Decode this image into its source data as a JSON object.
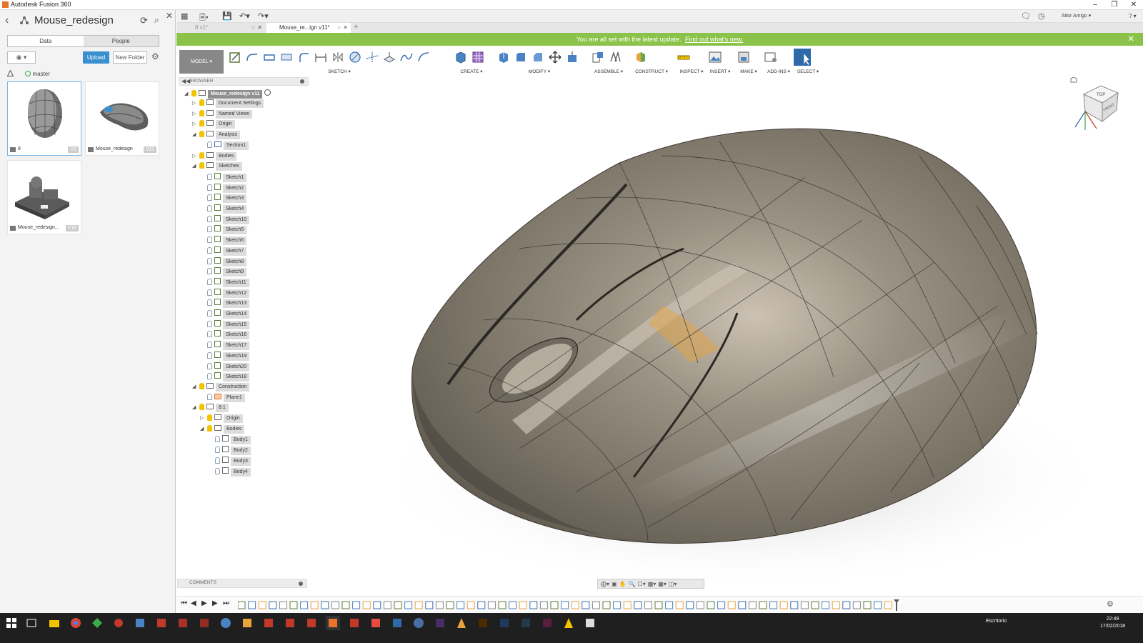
{
  "window": {
    "title": "Autodesk Fusion 360",
    "minimize": "–",
    "restore": "❐",
    "close": "✕"
  },
  "data_panel": {
    "back": "‹",
    "project_title": "Mouse_redesign",
    "refresh": "⟳",
    "search": "⌕",
    "close": "✕",
    "tabs": [
      "Data",
      "People"
    ],
    "active_tab": "Data",
    "view_toggle": "◉ ▾",
    "upload_label": "Upload",
    "new_folder_label": "New Folder",
    "settings": "⚙",
    "branch": "master",
    "files": [
      {
        "name": "8",
        "version": "V1"
      },
      {
        "name": "Mouse_redesign",
        "version": "V11"
      },
      {
        "name": "Mouse_redesign...",
        "version": "V16"
      }
    ]
  },
  "app_toolbar": {
    "user": "Aitor Amigo ▾",
    "help": "? ▾"
  },
  "doc_tabs": [
    {
      "label": "8 v1*",
      "active": false
    },
    {
      "label": "Mouse_re...ign v11*",
      "active": true
    }
  ],
  "banner": {
    "message": "You are all set with the latest update.",
    "link": "Find out what's new.",
    "close": "✕"
  },
  "ribbon": {
    "workspace": "MODEL ▾",
    "groups": [
      "SKETCH ▾",
      "CREATE ▾",
      "MODIFY ▾",
      "ASSEMBLE ▾",
      "CONSTRUCT ▾",
      "INSPECT ▾",
      "INSERT ▾",
      "MAKE ▾",
      "ADD-INS ▾",
      "SELECT ▾"
    ]
  },
  "browser": {
    "title": "BROWSER",
    "root": "Mouse_redesign v11",
    "nodes": [
      {
        "label": "Document Settings",
        "type": "gear",
        "expanded": false
      },
      {
        "label": "Named Views",
        "type": "folder",
        "expanded": false
      },
      {
        "label": "Origin",
        "type": "folder",
        "expanded": false
      },
      {
        "label": "Analysis",
        "type": "folder",
        "expanded": true
      },
      {
        "label": "Section1",
        "type": "section"
      },
      {
        "label": "Bodies",
        "type": "folder",
        "expanded": false
      },
      {
        "label": "Sketches",
        "type": "folder",
        "expanded": true
      },
      {
        "label": "Sketch1",
        "type": "sketch"
      },
      {
        "label": "Sketch2",
        "type": "sketch"
      },
      {
        "label": "Sketch3",
        "type": "sketch"
      },
      {
        "label": "Sketch4",
        "type": "sketch"
      },
      {
        "label": "Sketch10",
        "type": "sketch"
      },
      {
        "label": "Sketch5",
        "type": "sketch"
      },
      {
        "label": "Sketch6",
        "type": "sketch"
      },
      {
        "label": "Sketch7",
        "type": "sketch"
      },
      {
        "label": "Sketch8",
        "type": "sketch"
      },
      {
        "label": "Sketch9",
        "type": "sketch"
      },
      {
        "label": "Sketch11",
        "type": "sketch"
      },
      {
        "label": "Sketch12",
        "type": "sketch"
      },
      {
        "label": "Sketch13",
        "type": "sketch"
      },
      {
        "label": "Sketch14",
        "type": "sketch"
      },
      {
        "label": "Sketch15",
        "type": "sketch"
      },
      {
        "label": "Sketch16",
        "type": "sketch"
      },
      {
        "label": "Sketch17",
        "type": "sketch"
      },
      {
        "label": "Sketch19",
        "type": "sketch"
      },
      {
        "label": "Sketch20",
        "type": "sketch"
      },
      {
        "label": "Sketch18",
        "type": "sketch"
      },
      {
        "label": "Construction",
        "type": "folder",
        "expanded": true
      },
      {
        "label": "Plane1",
        "type": "plane"
      },
      {
        "label": "8:1",
        "type": "component",
        "expanded": true
      },
      {
        "label": "Origin",
        "type": "folder",
        "expanded": false
      },
      {
        "label": "Bodies",
        "type": "folder",
        "expanded": true
      },
      {
        "label": "Body1",
        "type": "body"
      },
      {
        "label": "Body2",
        "type": "body"
      },
      {
        "label": "Body3",
        "type": "body"
      },
      {
        "label": "Body4",
        "type": "body"
      }
    ]
  },
  "comments": {
    "title": "COMMENTS"
  },
  "taskbar": {
    "language": "Escritorio",
    "time": "22:49",
    "date": "17/02/2018"
  },
  "colors": {
    "banner": "#8bc34a",
    "upload": "#3a8fcf",
    "bulb": "#f2c300"
  }
}
